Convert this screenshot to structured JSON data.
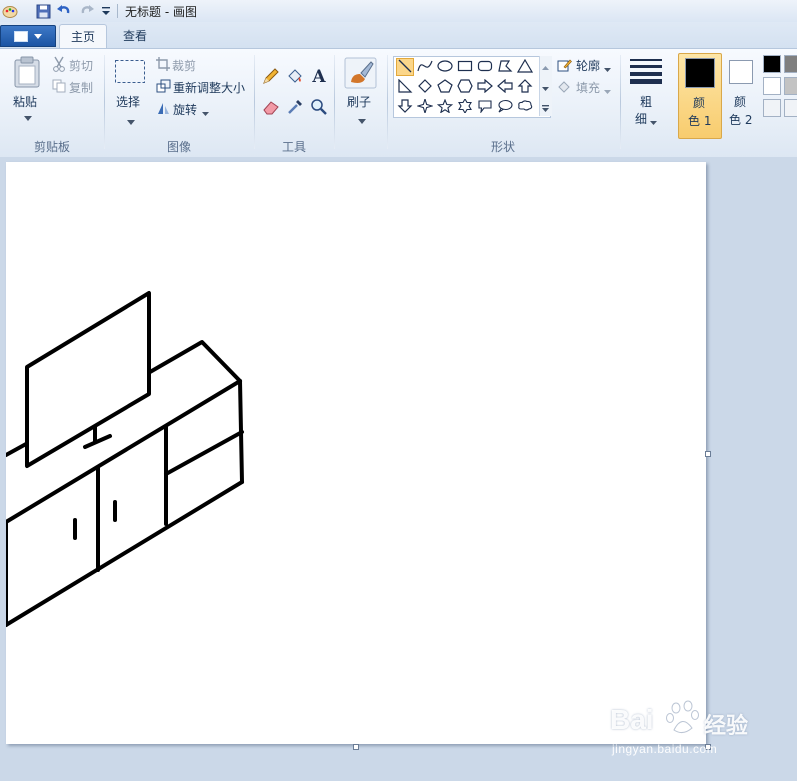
{
  "window": {
    "title": "无标题 - 画图"
  },
  "tabs": [
    {
      "label": "主页",
      "active": true
    },
    {
      "label": "查看",
      "active": false
    }
  ],
  "clipboard": {
    "paste": "粘贴",
    "cut": "剪切",
    "copy": "复制",
    "group": "剪贴板"
  },
  "image": {
    "select": "选择",
    "crop": "裁剪",
    "resize": "重新调整大小",
    "rotate": "旋转",
    "group": "图像"
  },
  "tools": {
    "group": "工具",
    "text_tool": "A"
  },
  "brushes": {
    "label": "刷子"
  },
  "shapes": {
    "outline": "轮廓",
    "fill": "填充",
    "group": "形状"
  },
  "size": {
    "line1": "粗",
    "line2": "细"
  },
  "colors": {
    "color1_line1": "颜",
    "color1_line2": "色 1",
    "color2_line1": "颜",
    "color2_line2": "色 2",
    "color1_value": "#000000",
    "color2_value": "#ffffff",
    "palette_visible": [
      "#000000",
      "#7f7f7f",
      "#ffffff",
      "#c3c3c3",
      "#ffffff",
      "#ffffff"
    ]
  },
  "watermark": {
    "brand": "Bai",
    "brand_suffix": "经验",
    "url": "jingyan.baidu.com"
  },
  "drawing": {
    "subject": "tv-cabinet-sketch"
  }
}
